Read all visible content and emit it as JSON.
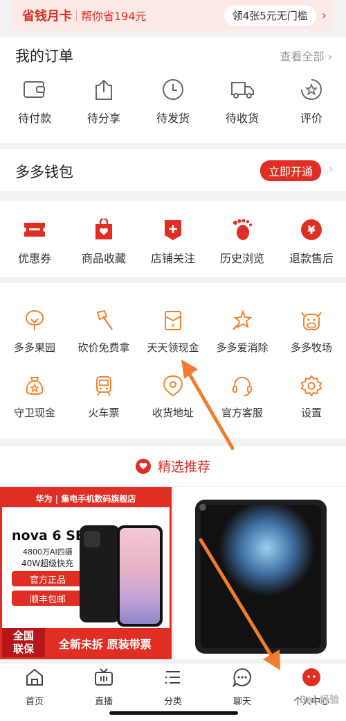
{
  "promo": {
    "title": "省钱月卡",
    "subtitle": "帮你省194元",
    "pill": "领4张5元无门槛"
  },
  "orders": {
    "title": "我的订单",
    "view_all": "查看全部",
    "items": [
      {
        "label": "待付款",
        "icon": "wallet-icon"
      },
      {
        "label": "待分享",
        "icon": "share-icon"
      },
      {
        "label": "待发货",
        "icon": "clock-icon"
      },
      {
        "label": "待收货",
        "icon": "truck-icon"
      },
      {
        "label": "评价",
        "icon": "review-star-icon"
      }
    ]
  },
  "wallet": {
    "title": "多多钱包",
    "button": "立即开通"
  },
  "services": {
    "items": [
      {
        "label": "优惠券",
        "icon": "coupon-icon"
      },
      {
        "label": "商品收藏",
        "icon": "favorite-bag-icon"
      },
      {
        "label": "店铺关注",
        "icon": "store-follow-icon"
      },
      {
        "label": "历史浏览",
        "icon": "footprint-icon"
      },
      {
        "label": "退款售后",
        "icon": "refund-icon"
      }
    ]
  },
  "tools": {
    "row1": [
      {
        "label": "多多果园",
        "icon": "tree-icon"
      },
      {
        "label": "砍价免费拿",
        "icon": "axe-icon"
      },
      {
        "label": "天天领现金",
        "icon": "cash-envelope-icon"
      },
      {
        "label": "多多爱消除",
        "icon": "star-wand-icon"
      },
      {
        "label": "多多牧场",
        "icon": "cow-icon"
      }
    ],
    "row2": [
      {
        "label": "守卫现金",
        "icon": "guard-bag-icon"
      },
      {
        "label": "火车票",
        "icon": "train-icon"
      },
      {
        "label": "收货地址",
        "icon": "location-icon"
      },
      {
        "label": "官方客服",
        "icon": "headset-icon"
      },
      {
        "label": "设置",
        "icon": "gear-icon"
      }
    ]
  },
  "recommend": {
    "label": "精选推荐"
  },
  "product_left": {
    "store": "华为 | 集电手机数码旗舰店",
    "model": "nova 6 SE",
    "line1": "4800万AI四摄",
    "line2": "40W超级快充",
    "tag1": "官方正品",
    "tag2": "顺丰包邮",
    "guarantee": "全国\n联保",
    "bottom": "全新未拆 原装带票"
  },
  "product_right": {
    "alt": "tablet"
  },
  "nav": {
    "items": [
      {
        "label": "首页",
        "icon": "home-icon"
      },
      {
        "label": "直播",
        "icon": "tv-icon"
      },
      {
        "label": "分类",
        "icon": "list-icon"
      },
      {
        "label": "聊天",
        "icon": "chat-icon"
      },
      {
        "label": "个人中心",
        "icon": "profile-icon"
      }
    ]
  },
  "watermark": "Bai 经验",
  "colors": {
    "brand": "#e02e24",
    "accent_orange": "#f07d2b",
    "tool_icon": "#f0842c"
  }
}
